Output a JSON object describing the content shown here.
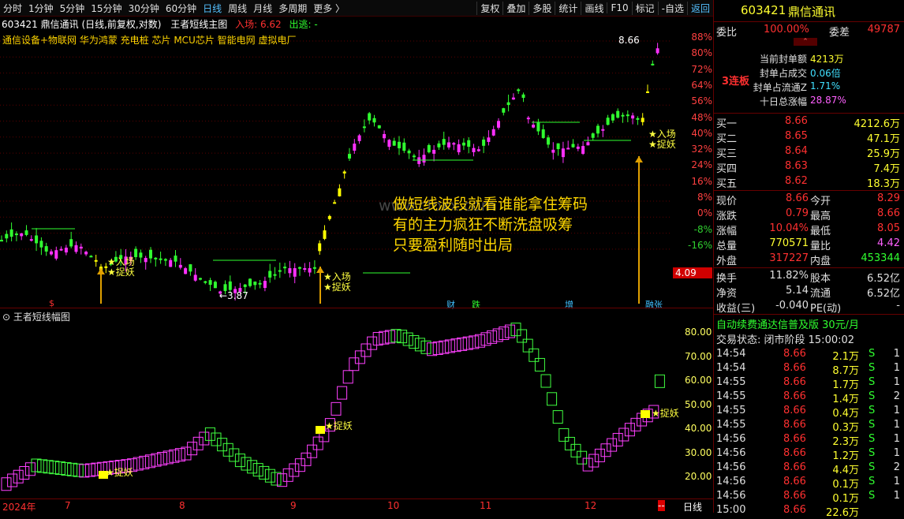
{
  "toolbar": {
    "left": [
      "分时",
      "1分钟",
      "5分钟",
      "15分钟",
      "30分钟",
      "60分钟",
      "日线",
      "周线",
      "月线",
      "多周期",
      "更多 〉"
    ],
    "right": [
      "复权",
      "叠加",
      "多股",
      "统计",
      "画线",
      "F10",
      "标记",
      "-自选",
      "返回"
    ]
  },
  "chart_header": {
    "code": "603421 鼎信通讯 (日线,前复权,对数)",
    "indicator": "王者短线主图",
    "entry": "入场: 6.62",
    "exit": "出逃: -"
  },
  "concepts": "通信设备+物联网 华为鸿蒙 充电桩 芯片 MCU芯片 智能电网 虚拟电厂",
  "axis_upper": [
    "88%",
    "80%",
    "72%",
    "64%",
    "56%",
    "48%",
    "40%",
    "32%",
    "24%",
    "16%",
    "8%",
    "0%",
    "-8%",
    "-16%"
  ],
  "price_tag": "4.09",
  "marks": {
    "hi": "8.66",
    "lo": "←3.87",
    "entry": "★入场",
    "catch": "★捉妖",
    "catch2": "★捉妖",
    "zz": "3连板"
  },
  "overlay": [
    "做短线波段就看谁能拿住筹码",
    "有的主力疯狂不断洗盘吸筹",
    "只要盈利随时出局"
  ],
  "watermark": "www.cfoxx.com",
  "event_tags": [
    "$",
    "财",
    "跌",
    "增",
    "融张"
  ],
  "sub_title": "王者短线幅图",
  "axis_lower": [
    "80.00",
    "70.00",
    "60.00",
    "50.00",
    "40.00",
    "30.00",
    "20.00"
  ],
  "xaxis": [
    "2024年",
    "7",
    "8",
    "9",
    "10",
    "11",
    "12",
    "--",
    "日线"
  ],
  "quote": {
    "code": "603421",
    "name": "鼎信通讯",
    "weibi": "委比",
    "weibi_v": "100.00%",
    "weicha": "委差",
    "weicha_v": "49787",
    "lb": "3连板",
    "info": [
      [
        "当前封单额",
        "4213万"
      ],
      [
        "封单占成交",
        "0.06倍"
      ],
      [
        "封单占流通Z",
        "1.71%"
      ],
      [
        "十日总涨幅",
        "28.87%"
      ]
    ],
    "buys": [
      [
        "买一",
        "8.66",
        "4212.6万"
      ],
      [
        "买二",
        "8.65",
        "47.1万"
      ],
      [
        "买三",
        "8.64",
        "25.9万"
      ],
      [
        "买四",
        "8.63",
        "7.4万"
      ],
      [
        "买五",
        "8.62",
        "18.3万"
      ]
    ],
    "stats": [
      [
        "现价",
        "8.66",
        "今开",
        "8.29"
      ],
      [
        "涨跌",
        "0.79",
        "最高",
        "8.66"
      ],
      [
        "涨幅",
        "10.04%",
        "最低",
        "8.05"
      ],
      [
        "总量",
        "770571",
        "量比",
        "4.42"
      ],
      [
        "外盘",
        "317227",
        "内盘",
        "453344"
      ]
    ],
    "stats2": [
      [
        "换手",
        "11.82%",
        "股本",
        "6.52亿"
      ],
      [
        "净资",
        "5.14",
        "流通",
        "6.52亿"
      ],
      [
        "收益(三)",
        "-0.040",
        "PE(动)",
        "-"
      ]
    ],
    "ad": "自动续费通达信普及版  30元/月",
    "status": "交易状态: 闭市阶段 15:00:02",
    "ticks": [
      [
        "14:54",
        "8.66",
        "2.1万",
        "S",
        "1"
      ],
      [
        "14:54",
        "8.66",
        "8.7万",
        "S",
        "1"
      ],
      [
        "14:55",
        "8.66",
        "1.7万",
        "S",
        "1"
      ],
      [
        "14:55",
        "8.66",
        "1.4万",
        "S",
        "2"
      ],
      [
        "14:55",
        "8.66",
        "0.4万",
        "S",
        "1"
      ],
      [
        "14:55",
        "8.66",
        "0.3万",
        "S",
        "1"
      ],
      [
        "14:56",
        "8.66",
        "2.3万",
        "S",
        "1"
      ],
      [
        "14:56",
        "8.66",
        "1.2万",
        "S",
        "1"
      ],
      [
        "14:56",
        "8.66",
        "4.4万",
        "S",
        "2"
      ],
      [
        "14:56",
        "8.66",
        "0.1万",
        "S",
        "1"
      ],
      [
        "14:56",
        "8.66",
        "0.1万",
        "S",
        "1"
      ],
      [
        "15:00",
        "8.66",
        "22.6万",
        "",
        ""
      ]
    ]
  }
}
